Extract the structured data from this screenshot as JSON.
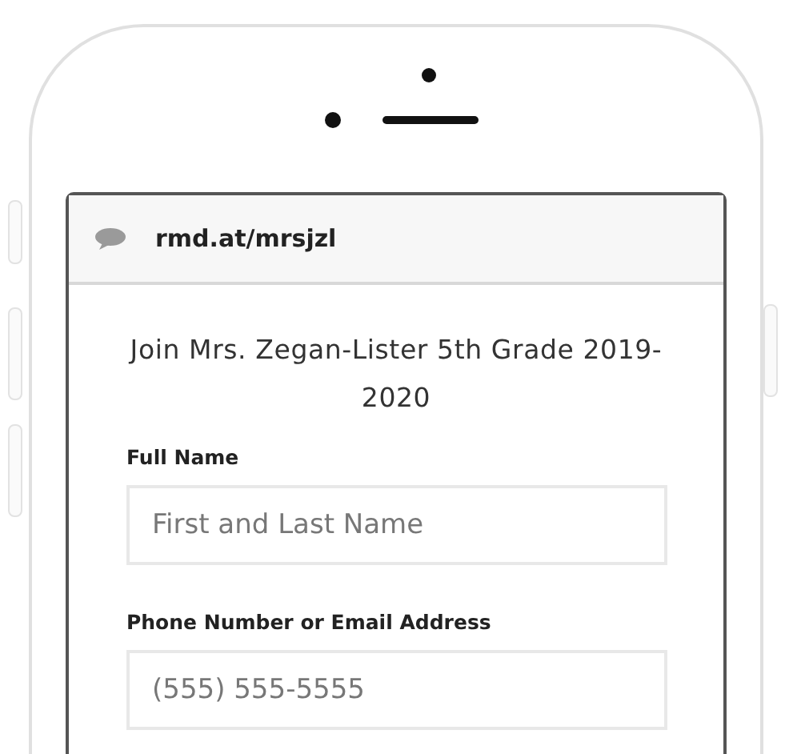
{
  "browser": {
    "url": "rmd.at/mrsjzl"
  },
  "page": {
    "title": "Join Mrs. Zegan-Lister 5th Grade 2019-2020"
  },
  "fields": [
    {
      "label": "Full Name",
      "placeholder": "First and Last Name"
    },
    {
      "label": "Phone Number or Email Address",
      "placeholder": "(555) 555-5555"
    }
  ]
}
